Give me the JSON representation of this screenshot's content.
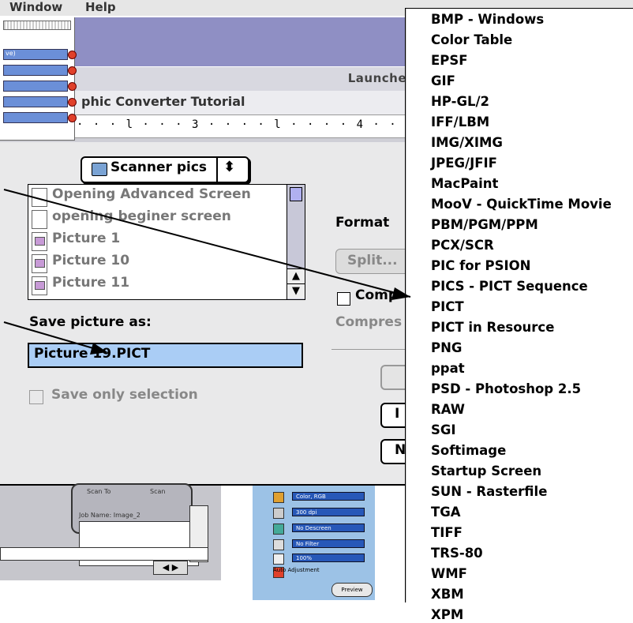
{
  "menubar": {
    "items": [
      "Window",
      "Help"
    ]
  },
  "background_window": {
    "launch_label": "Launche",
    "tutorial_title": "phic Converter Tutorial",
    "ruler_text": "· · · l · · · 3 · · · · l · · · · 4 · · · · l · · · · 5 · · · · l ·",
    "palette_row_label": "ve)"
  },
  "dialog": {
    "folder_popup": "Scanner pics",
    "folder_popup_arrows": "⬍",
    "files": [
      {
        "name": "Opening Advanced Screen",
        "icon": "document-icon"
      },
      {
        "name": "opening beginer screen",
        "icon": "document-icon"
      },
      {
        "name": "Picture 1",
        "icon": "pict-file-icon"
      },
      {
        "name": "Picture 10",
        "icon": "pict-file-icon"
      },
      {
        "name": "Picture 11",
        "icon": "pict-file-icon"
      }
    ],
    "save_as_label": "Save picture as:",
    "filename_value": "Picture 19.PICT",
    "save_only_selection": "Save only selection",
    "format_label": "Format",
    "split_button": "Split...",
    "compress_checkbox": "Comp",
    "compression_label": "Compres",
    "button_b": "I",
    "button_c": "N"
  },
  "lower_snippets": {
    "scan_to": "Scan To",
    "scan": "Scan",
    "job_name": "Job Name: Image_2",
    "right_rows": [
      "Color, RGB",
      "300 dpi",
      "No Descreen",
      "No Filter",
      "100%"
    ],
    "auto_adjustment": "Auto Adjustment",
    "preview": "Preview"
  },
  "format_menu": {
    "items": [
      "BMP - Windows",
      "Color Table",
      "EPSF",
      "GIF",
      "HP-GL/2",
      "IFF/LBM",
      "IMG/XIMG",
      "JPEG/JFIF",
      "MacPaint",
      "MooV - QuickTime Movie",
      "PBM/PGM/PPM",
      "PCX/SCR",
      "PIC for PSION",
      "PICS - PICT Sequence",
      "PICT",
      "PICT in Resource",
      "PNG",
      "ppat",
      "PSD - Photoshop 2.5",
      "RAW",
      "SGI",
      "Softimage",
      "Startup Screen",
      "SUN - Rasterfile",
      "TGA",
      "TIFF",
      "TRS-80",
      "WMF",
      "XBM",
      "XPM"
    ],
    "selected": "PICT"
  },
  "colors": {
    "highlight": "#aacdf5",
    "titlebar": "#8f8fc4",
    "accent_red": "#e0402a"
  }
}
